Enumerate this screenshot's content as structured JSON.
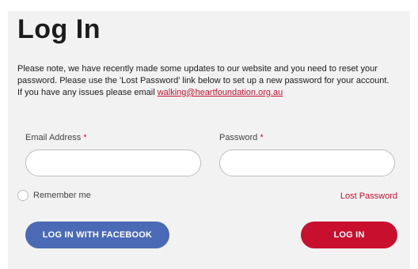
{
  "page": {
    "title": "Log In",
    "notice_text": "Please note, we have recently made some updates to our website and you need to reset your password. Please use the 'Lost Password' link below to set up a new password for your account. If you have any issues please email ",
    "notice_email": "walking@heartfoundation.org.au"
  },
  "form": {
    "email_label": "Email Address",
    "password_label": "Password",
    "required_marker": "*",
    "email_value": "",
    "password_value": "",
    "remember_label": "Remember me",
    "remember_checked": false,
    "lost_password": "Lost Password",
    "facebook_button": "LOG IN WITH FACEBOOK",
    "login_button": "LOG IN"
  },
  "colors": {
    "accent_red": "#c8102e",
    "facebook_blue": "#4a6ab5",
    "panel_bg": "#f2f2f2"
  }
}
